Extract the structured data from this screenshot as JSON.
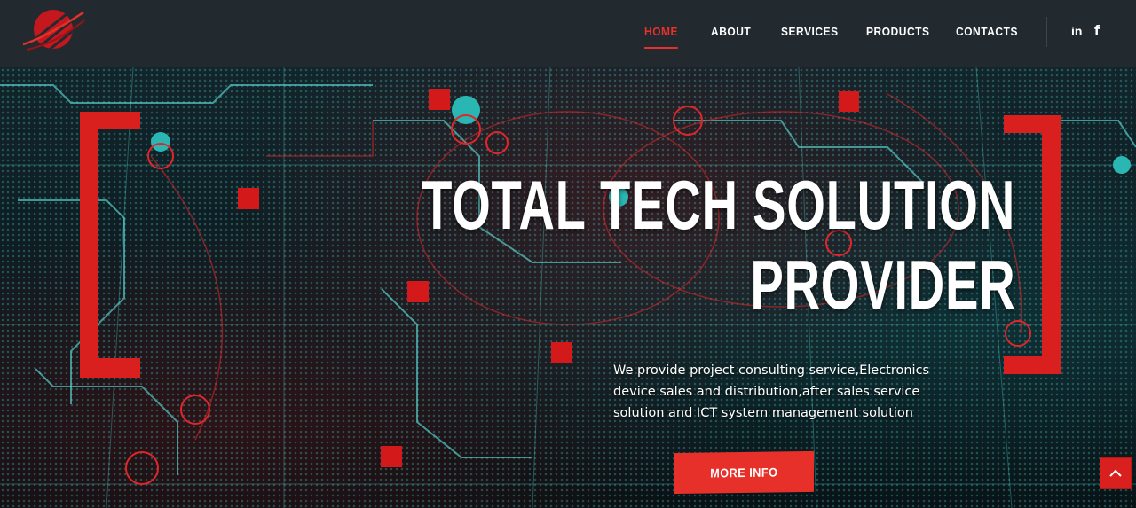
{
  "brand": {
    "logo_icon": "red-striped-globe-logo",
    "accent_color": "#e8302a"
  },
  "nav": {
    "items": [
      {
        "label": "HOME",
        "active": true
      },
      {
        "label": "ABOUT",
        "active": false
      },
      {
        "label": "SERVICES",
        "active": false
      },
      {
        "label": "PRODUCTS",
        "active": false
      },
      {
        "label": "CONTACTS",
        "active": false
      }
    ]
  },
  "social": {
    "linkedin": "in",
    "facebook": "f"
  },
  "hero": {
    "title_line1": "TOTAL TECH SOLUTION",
    "title_line2": "PROVIDER",
    "description": "We provide project consulting service,Electronics device sales and distribution,after sales service solution and ICT system management solution",
    "cta_label": "MORE INFO",
    "scroll_top_icon": "chevron-up-icon",
    "bracket_color": "#d9201f"
  }
}
